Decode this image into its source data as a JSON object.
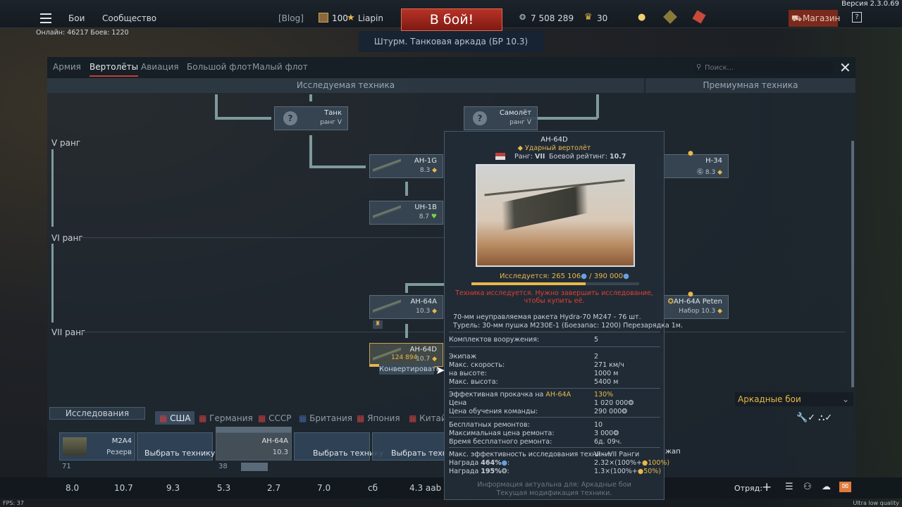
{
  "version": "Версия 2.3.0.69",
  "topbar": {
    "battles": "Бои",
    "community": "Сообщество",
    "blog": "[Blog]",
    "level": "100",
    "user": "Liapin",
    "battle_btn": "В бой!",
    "silver": "7 508 289",
    "gold": "30",
    "shop": "Магазин",
    "help": "?"
  },
  "online": "Онлайн: 46217 Боев: 1220",
  "mode": "Штурм. Танковая аркада (БР 10.3)",
  "tabs": [
    "Армия",
    "Вертолёты",
    "Авиация",
    "Большой флот",
    "Малый флот"
  ],
  "search_placeholder": "Поиск...",
  "col_research": "Исследуемая техника",
  "col_premium": "Премиумная техника",
  "ranks": [
    "V ранг",
    "VI ранг",
    "VII ранг"
  ],
  "cards": {
    "tank": {
      "name": "Танк",
      "rank": "ранг V"
    },
    "plane": {
      "name": "Самолёт",
      "rank": "ранг V"
    },
    "ah1g": {
      "name": "AH-1G",
      "br": "8.3"
    },
    "uh1b": {
      "name": "UH-1B",
      "br": "8.7"
    },
    "ah64a": {
      "name": "AH-64A",
      "br": "10.3"
    },
    "ah64d": {
      "name": "AH-64D",
      "br": "10.7",
      "progress": "124 894"
    },
    "h34": {
      "name": "H-34",
      "br": "8.3"
    },
    "ah64a_peten": {
      "name": "AH-64A Peten",
      "br": "Набор 10.3"
    }
  },
  "convert": "Конвертировать",
  "tooltip": {
    "name": "AH-64D",
    "type": "Ударный вертолёт",
    "rank_label": "Ранг:",
    "rank": "VII",
    "br_label": "Боевой рейтинг:",
    "br": "10.7",
    "research_label": "Исследуется:",
    "research_cur": "265 106",
    "research_total": "390 000",
    "research_fraction": 0.68,
    "warn": "Техника исследуется. Нужно завершить исследование, чтобы купить её.",
    "arm1": "70-мм неуправляемая ракета Hydra-70 M247 - 76 шт.",
    "arm2": "Турель: 30-мм пушка M230E-1 (Боезапас: 1200) Перезарядка 1м.",
    "sets_label": "Комплектов вооружения:",
    "sets": "5",
    "crew_label": "Экипаж",
    "crew": "2",
    "speed_label": "Макс. скорость:",
    "speed": "271 км/ч",
    "alt_label": "на высоте:",
    "alt": "1000 м",
    "ceil_label": "Макс. высота:",
    "ceil": "5400 м",
    "eff_label": "Эффективная прокачка на",
    "eff_target": "AH-64A",
    "eff": "130%",
    "price_label": "Цена",
    "price": "1 020 000",
    "crew_train_label": "Цена обучения команды:",
    "crew_train": "290 000",
    "free_rep_label": "Бесплатных ремонтов:",
    "free_rep": "10",
    "max_rep_label": "Максимальная цена ремонта:",
    "max_rep": "3 000",
    "rep_time_label": "Время бесплатного ремонта:",
    "rep_time": "6д. 09ч.",
    "max_eff_label": "Макс. эффективность исследования техники:",
    "max_eff": "VI – VII Ранги",
    "rw1_label": "Награда",
    "rw1_pct": "464%",
    "rw1": "2.32×(100%+",
    "rw1_b": "100%)",
    "rw2_label": "Награда",
    "rw2_pct": "195%",
    "rw2": "1.3×(100%+",
    "rw2_b": "50%)",
    "foot1": "Информация актуальна для: Аркадные бои",
    "foot2": "Текущая модификация техники."
  },
  "mode_select": "Аркадные бои",
  "research_btn": "Исследования",
  "countries": [
    "США",
    "Германия",
    "СССР",
    "Британия",
    "Япония",
    "Китай"
  ],
  "slots": [
    {
      "name": "M2A4",
      "sub": "Резерв",
      "num": "71"
    },
    {
      "name": "Выбрать технику"
    },
    {
      "name": "AH-64A",
      "br": "10.3",
      "num": "38"
    },
    {
      "name": "Выбрать технику"
    },
    {
      "name": "Выбрать технику"
    }
  ],
  "slot_right": "жап",
  "br_list": [
    "8.0",
    "10.7",
    "9.3",
    "5.3",
    "2.7",
    "7.0",
    "сб",
    "4.3 aab"
  ],
  "squad": "Отряд:",
  "fps": "FPS: 37",
  "quality": "Ultra low quality",
  "colors": {
    "accent": "#b83226",
    "gold": "#e8b84a",
    "warn": "#d83a2a",
    "green": "#7ed04a"
  }
}
